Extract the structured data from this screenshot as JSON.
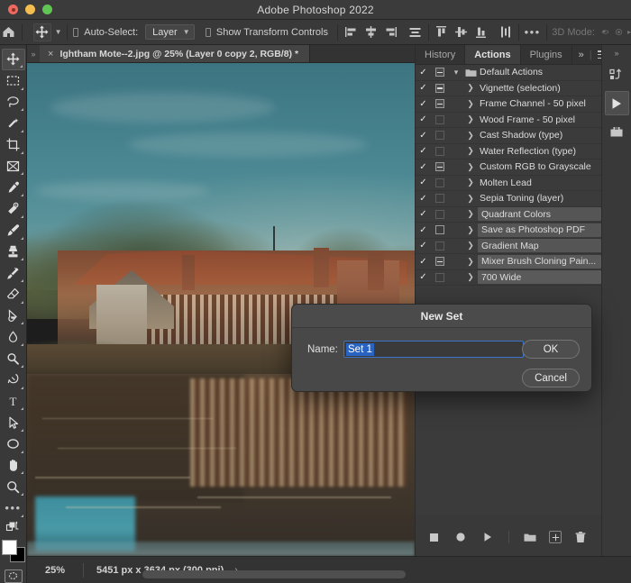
{
  "window": {
    "title": "Adobe Photoshop 2022",
    "traffic_lights": [
      "close",
      "minimize",
      "maximize"
    ]
  },
  "options_bar": {
    "home_icon": "home-icon",
    "tool_icon": "move-tool-icon",
    "auto_select_label": "Auto-Select:",
    "auto_select_value": "Layer",
    "show_transform_label": "Show Transform Controls",
    "more_label": "•••",
    "three_d_mode_label": "3D Mode:",
    "align_icons": [
      "align-left-edges-icon",
      "align-horizontal-centers-icon",
      "align-right-edges-icon",
      "distribute-horizontally-icon",
      "align-top-edges-icon",
      "align-vertical-centers-icon",
      "align-bottom-edges-icon",
      "distribute-vertically-icon"
    ]
  },
  "toolbar": {
    "tools": [
      {
        "name": "move-tool",
        "active": true
      },
      {
        "name": "rectangular-marquee-tool",
        "active": false
      },
      {
        "name": "lasso-tool",
        "active": false
      },
      {
        "name": "object-selection-tool",
        "active": false
      },
      {
        "name": "crop-tool",
        "active": false
      },
      {
        "name": "frame-tool",
        "active": false
      },
      {
        "name": "eyedropper-tool",
        "active": false
      },
      {
        "name": "spot-healing-brush-tool",
        "active": false
      },
      {
        "name": "brush-tool",
        "active": false
      },
      {
        "name": "clone-stamp-tool",
        "active": false
      },
      {
        "name": "history-brush-tool",
        "active": false
      },
      {
        "name": "eraser-tool",
        "active": false
      },
      {
        "name": "gradient-tool",
        "active": false
      },
      {
        "name": "blur-tool",
        "active": false
      },
      {
        "name": "dodge-tool",
        "active": false
      },
      {
        "name": "pen-tool",
        "active": false
      },
      {
        "name": "type-tool",
        "active": false
      },
      {
        "name": "path-selection-tool",
        "active": false
      },
      {
        "name": "ellipse-tool",
        "active": false
      },
      {
        "name": "hand-tool",
        "active": false
      },
      {
        "name": "zoom-tool",
        "active": false
      },
      {
        "name": "edit-toolbar-tool",
        "active": false
      }
    ],
    "foreground_color": "#ffffff",
    "background_color": "#000000",
    "quick_mask": "quick-mask-icon"
  },
  "document": {
    "tab_title": "Ightham Mote--2.jpg @ 25% (Layer 0 copy 2, RGB/8) *",
    "close_glyph": "×"
  },
  "status_bar": {
    "zoom": "25%",
    "dimensions": "5451 px x 3634 px (300 ppi)",
    "arrow": "›"
  },
  "panel": {
    "tabs": [
      {
        "label": "History",
        "active": false
      },
      {
        "label": "Actions",
        "active": true
      },
      {
        "label": "Plugins",
        "active": false
      }
    ],
    "overflow_glyph": "»",
    "menu_icon": "panel-menu-icon",
    "rows": [
      {
        "label": "Default Actions",
        "checked": true,
        "dialog": "filled",
        "expanded": true,
        "is_set": true,
        "highlight": "none"
      },
      {
        "label": "Vignette (selection)",
        "checked": true,
        "dialog": "filled",
        "expanded": false,
        "is_set": false,
        "highlight": "none"
      },
      {
        "label": "Frame Channel - 50 pixel",
        "checked": true,
        "dialog": "filled",
        "expanded": false,
        "is_set": false,
        "highlight": "none"
      },
      {
        "label": "Wood Frame - 50 pixel",
        "checked": true,
        "dialog": "none",
        "expanded": false,
        "is_set": false,
        "highlight": "none"
      },
      {
        "label": "Cast Shadow (type)",
        "checked": true,
        "dialog": "none",
        "expanded": false,
        "is_set": false,
        "highlight": "none"
      },
      {
        "label": "Water Reflection (type)",
        "checked": true,
        "dialog": "none",
        "expanded": false,
        "is_set": false,
        "highlight": "none"
      },
      {
        "label": "Custom RGB to Grayscale",
        "checked": true,
        "dialog": "filled",
        "expanded": false,
        "is_set": false,
        "highlight": "none"
      },
      {
        "label": "Molten Lead",
        "checked": true,
        "dialog": "none",
        "expanded": false,
        "is_set": false,
        "highlight": "none"
      },
      {
        "label": "Sepia Toning (layer)",
        "checked": true,
        "dialog": "none",
        "expanded": false,
        "is_set": false,
        "highlight": "none"
      },
      {
        "label": "Quadrant Colors",
        "checked": true,
        "dialog": "none",
        "expanded": false,
        "is_set": false,
        "highlight": "soft"
      },
      {
        "label": "Save as Photoshop PDF",
        "checked": true,
        "dialog": "hollow",
        "expanded": false,
        "is_set": false,
        "highlight": "soft"
      },
      {
        "label": "Gradient Map",
        "checked": true,
        "dialog": "none",
        "expanded": false,
        "is_set": false,
        "highlight": "soft"
      },
      {
        "label": "Mixer Brush Cloning Pain...",
        "checked": true,
        "dialog": "filled",
        "expanded": false,
        "is_set": false,
        "highlight": "soft"
      },
      {
        "label": "700 Wide",
        "checked": true,
        "dialog": "none",
        "expanded": false,
        "is_set": false,
        "highlight": "soft"
      }
    ],
    "footer_buttons": [
      {
        "name": "stop-playing-button",
        "glyph": "stop"
      },
      {
        "name": "begin-recording-button",
        "glyph": "record"
      },
      {
        "name": "play-selection-button",
        "glyph": "play"
      },
      {
        "name": "create-new-set-button",
        "glyph": "folder"
      },
      {
        "name": "create-new-action-button",
        "glyph": "plus"
      },
      {
        "name": "delete-button",
        "glyph": "trash"
      }
    ]
  },
  "dock_strip": {
    "buttons": [
      {
        "name": "libraries-icon",
        "selected": false
      },
      {
        "name": "play-action-icon",
        "selected": true
      },
      {
        "name": "properties-icon",
        "selected": false
      }
    ],
    "collapse_glyph": "»"
  },
  "dialog": {
    "title": "New Set",
    "name_label": "Name:",
    "name_value": "Set 1",
    "ok_label": "OK",
    "cancel_label": "Cancel",
    "accent_color": "#2a64c2"
  }
}
